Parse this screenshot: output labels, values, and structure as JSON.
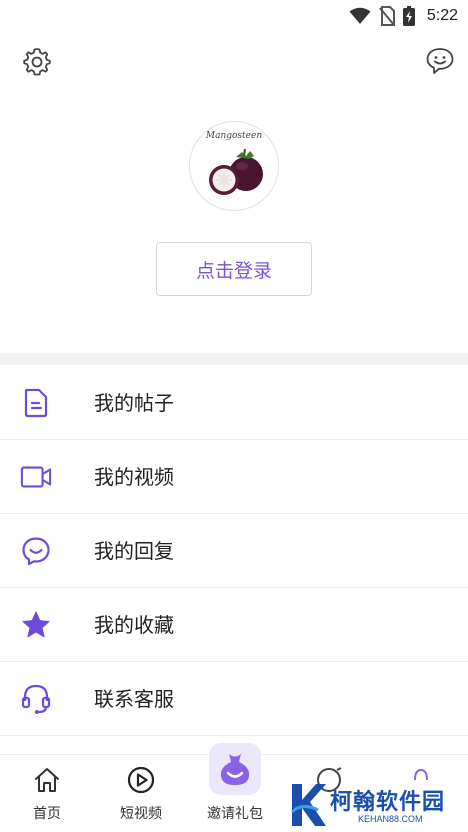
{
  "status_bar": {
    "time": "5:22",
    "icons": [
      "wifi-icon",
      "no-sim-icon",
      "battery-charging-icon"
    ]
  },
  "header": {
    "left_icon": "settings-gear-icon",
    "right_icon": "chat-bubble-icon"
  },
  "profile": {
    "avatar_caption": "Mangosteen",
    "login_label": "点击登录"
  },
  "colors": {
    "accent": "#7a52d8",
    "icon_purple": "#6f4bd8",
    "divider": "#f2f2f2",
    "watermark": "#1b4fae"
  },
  "menu": {
    "items": [
      {
        "label": "我的帖子",
        "icon": "document-icon"
      },
      {
        "label": "我的视频",
        "icon": "video-camera-icon"
      },
      {
        "label": "我的回复",
        "icon": "reply-bubble-icon"
      },
      {
        "label": "我的收藏",
        "icon": "star-icon"
      },
      {
        "label": "联系客服",
        "icon": "headset-icon"
      }
    ]
  },
  "bottom_nav": {
    "items": [
      {
        "label": "首页",
        "icon": "home-icon"
      },
      {
        "label": "短视频",
        "icon": "play-circle-icon"
      },
      {
        "label": "邀请礼包",
        "icon": "gift-bag-icon"
      },
      {
        "label": "",
        "icon": "explore-icon"
      },
      {
        "label": "",
        "icon": "profile-icon"
      }
    ]
  },
  "watermark": {
    "text": "柯翰软件园",
    "sub": "KEHAN88.COM"
  }
}
